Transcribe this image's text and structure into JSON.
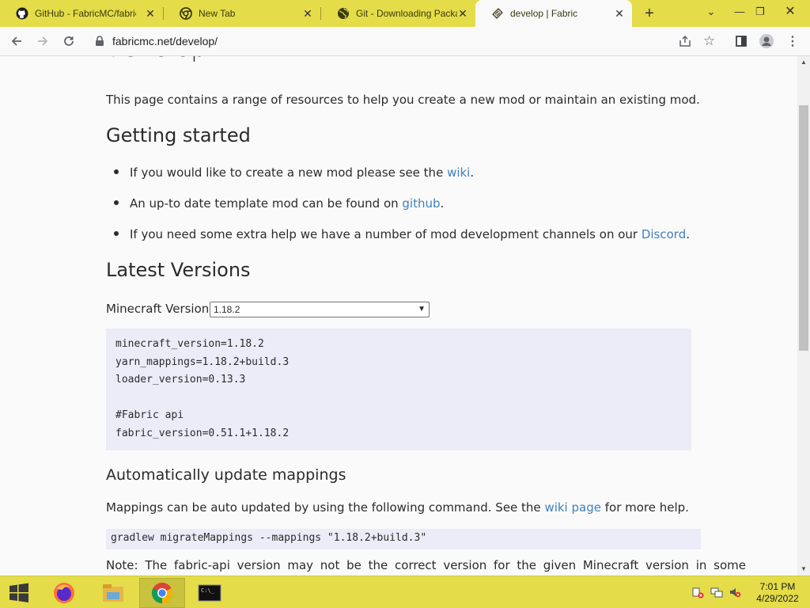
{
  "browser": {
    "tabs": [
      {
        "title": "GitHub - FabricMC/fabric",
        "icon": "github-icon"
      },
      {
        "title": "New Tab",
        "icon": "chrome-icon"
      },
      {
        "title": "Git - Downloading Packa",
        "icon": "globe-icon"
      },
      {
        "title": "develop | Fabric",
        "icon": "fabric-icon",
        "active": true
      }
    ],
    "url": "fabricmc.net/develop/"
  },
  "page": {
    "title": "develop",
    "intro": "This page contains a range of resources to help you create a new mod or maintain an existing mod.",
    "getting_started": {
      "heading": "Getting started",
      "items": [
        {
          "before": "If you would like to create a new mod please see the ",
          "link": "wiki",
          "after": "."
        },
        {
          "before": "An up-to date template mod can be found on ",
          "link": "github",
          "after": "."
        },
        {
          "before": "If you need some extra help we have a number of mod development channels on our ",
          "link": "Discord",
          "after": "."
        }
      ]
    },
    "latest_versions": {
      "heading": "Latest Versions",
      "mc_label": "Minecraft Version:",
      "mc_selected": "1.18.2",
      "code_lines": [
        "minecraft_version=1.18.2",
        "yarn_mappings=1.18.2+build.3",
        "loader_version=0.13.3",
        "",
        "#Fabric api",
        "fabric_version=0.51.1+1.18.2"
      ]
    },
    "auto_update": {
      "heading": "Automatically update mappings",
      "text_before": "Mappings can be auto updated by using the following command. See the ",
      "link": "wiki page",
      "text_after": " for more help.",
      "command": "gradlew migrateMappings --mappings \"1.18.2+build.3\""
    },
    "note": "Note: The fabric-api version may not be the correct version for the given Minecraft version in some"
  },
  "taskbar": {
    "apps": [
      "start-button",
      "firefox-icon",
      "file-explorer-icon",
      "chrome-icon",
      "cmd-icon"
    ],
    "time": "7:01 PM",
    "date": "4/29/2022"
  },
  "colors": {
    "chrome_frame": "#e4dc49",
    "link": "#3f7fbf",
    "code_bg": "#ecebf8"
  }
}
